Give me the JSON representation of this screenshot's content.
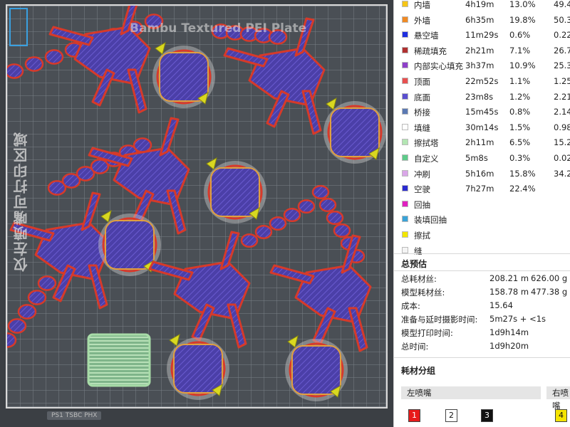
{
  "plate": {
    "name": "Bambu Textured PEI Plate",
    "side_label": "仅左喷嘴可打印区域",
    "badge": "PS1 TSBC PHX"
  },
  "legend": [
    {
      "name": "内墙",
      "time": "4h19m",
      "percent": "13.0%",
      "weight": "49.4",
      "color": "#f5c518"
    },
    {
      "name": "外墙",
      "time": "6h35m",
      "percent": "19.8%",
      "weight": "50.3",
      "color": "#f08a24"
    },
    {
      "name": "悬空墙",
      "time": "11m29s",
      "percent": "0.6%",
      "weight": "0.22",
      "color": "#1f2fe0"
    },
    {
      "name": "稀疏填充",
      "time": "2h21m",
      "percent": "7.1%",
      "weight": "26.7",
      "color": "#b03030"
    },
    {
      "name": "内部实心填充",
      "time": "3h37m",
      "percent": "10.9%",
      "weight": "25.3",
      "color": "#8e3fc9"
    },
    {
      "name": "顶面",
      "time": "22m52s",
      "percent": "1.1%",
      "weight": "1.25",
      "color": "#e85050"
    },
    {
      "name": "底面",
      "time": "23m8s",
      "percent": "1.2%",
      "weight": "2.21",
      "color": "#5a4fcf"
    },
    {
      "name": "桥接",
      "time": "15m45s",
      "percent": "0.8%",
      "weight": "2.14",
      "color": "#5b79b3"
    },
    {
      "name": "填缝",
      "time": "30m14s",
      "percent": "1.5%",
      "weight": "0.98",
      "color": "#ffffff"
    },
    {
      "name": "擦拭塔",
      "time": "2h11m",
      "percent": "6.5%",
      "weight": "15.2",
      "color": "#b3e6b3"
    },
    {
      "name": "自定义",
      "time": "5m8s",
      "percent": "0.3%",
      "weight": "0.02",
      "color": "#5ecb8a"
    },
    {
      "name": "冲刷",
      "time": "5h16m",
      "percent": "15.8%",
      "weight": "34.2",
      "color": "#d9a6e8"
    },
    {
      "name": "空驶",
      "time": "7h27m",
      "percent": "22.4%",
      "weight": "",
      "color": "#2a2ad0"
    },
    {
      "name": "回抽",
      "time": "",
      "percent": "",
      "weight": "",
      "color": "#e020c0"
    },
    {
      "name": "装填回抽",
      "time": "",
      "percent": "",
      "weight": "",
      "color": "#3aa3d8"
    },
    {
      "name": "擦拭",
      "time": "",
      "percent": "",
      "weight": "",
      "color": "#f2e600"
    },
    {
      "name": "缝",
      "time": "",
      "percent": "",
      "weight": "",
      "color": "#f4f4f4"
    }
  ],
  "summary": {
    "title": "总预估",
    "rows": [
      {
        "label": "总耗材丝:",
        "v1": "208.21 m",
        "v2": "626.00 g"
      },
      {
        "label": "模型耗材丝:",
        "v1": "158.78 m",
        "v2": "477.38 g"
      },
      {
        "label": "成本:",
        "v1": "15.64",
        "v2": ""
      },
      {
        "label": "准备与延时摄影时间:",
        "v1": "5m27s + <1s",
        "v2": ""
      },
      {
        "label": "模型打印时间:",
        "v1": "1d9h14m",
        "v2": ""
      },
      {
        "label": "总时间:",
        "v1": "1d9h20m",
        "v2": ""
      }
    ]
  },
  "filament_groups": {
    "title": "耗材分组",
    "left_label": "左喷嘴",
    "right_label": "右喷嘴",
    "slots": [
      {
        "num": "1",
        "color": "#e81b1b"
      },
      {
        "num": "2",
        "color": "#ffffff"
      },
      {
        "num": "3",
        "color": "#111111"
      },
      {
        "num": "4",
        "color": "#f5e400"
      }
    ]
  }
}
